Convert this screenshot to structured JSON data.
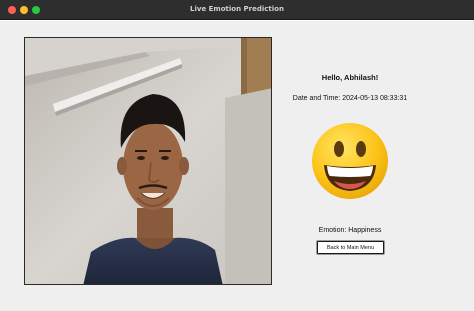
{
  "window": {
    "title": "Live Emotion Prediction"
  },
  "camera": {
    "feed_description_icon": "webcam-feed"
  },
  "prediction": {
    "greeting": "Hello, Abhilash!",
    "datetime": "Date and Time: 2024-05-13 08:33:31",
    "emotion_text": "Emotion: Happiness",
    "emoji_icon": "grinning-face-emoji"
  },
  "actions": {
    "back_label": "Back to Main Menu"
  },
  "colors": {
    "titlebar": "#2e2e2e",
    "content_bg": "#efefef",
    "close": "#fe5f57",
    "minimize": "#febc2e",
    "zoom": "#28c840"
  }
}
